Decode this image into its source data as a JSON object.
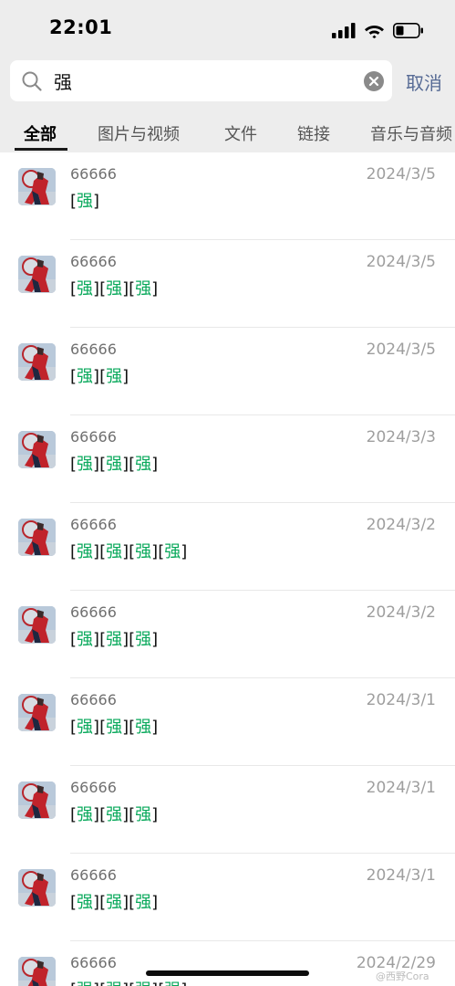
{
  "status_bar": {
    "time": "22:01",
    "icons": [
      "cellular-signal-icon",
      "wifi-icon",
      "battery-icon"
    ]
  },
  "search": {
    "value": "强",
    "cancel_label": "取消"
  },
  "tabs": [
    {
      "label": "全部",
      "active": true
    },
    {
      "label": "图片与视频",
      "active": false
    },
    {
      "label": "文件",
      "active": false
    },
    {
      "label": "链接",
      "active": false
    },
    {
      "label": "音乐与音频",
      "active": false
    }
  ],
  "results": [
    {
      "name": "66666",
      "date": "2024/3/5",
      "count": 1
    },
    {
      "name": "66666",
      "date": "2024/3/5",
      "count": 3
    },
    {
      "name": "66666",
      "date": "2024/3/5",
      "count": 2
    },
    {
      "name": "66666",
      "date": "2024/3/3",
      "count": 3
    },
    {
      "name": "66666",
      "date": "2024/3/2",
      "count": 4
    },
    {
      "name": "66666",
      "date": "2024/3/2",
      "count": 3
    },
    {
      "name": "66666",
      "date": "2024/3/1",
      "count": 3
    },
    {
      "name": "66666",
      "date": "2024/3/1",
      "count": 3
    },
    {
      "name": "66666",
      "date": "2024/3/1",
      "count": 3
    },
    {
      "name": "66666",
      "date": "2024/2/29",
      "count": 4
    }
  ],
  "highlight_term": "强",
  "watermark": "@西野Cora",
  "colors": {
    "header_bg": "#ededed",
    "highlight": "#07a85a",
    "link": "#576b95"
  }
}
